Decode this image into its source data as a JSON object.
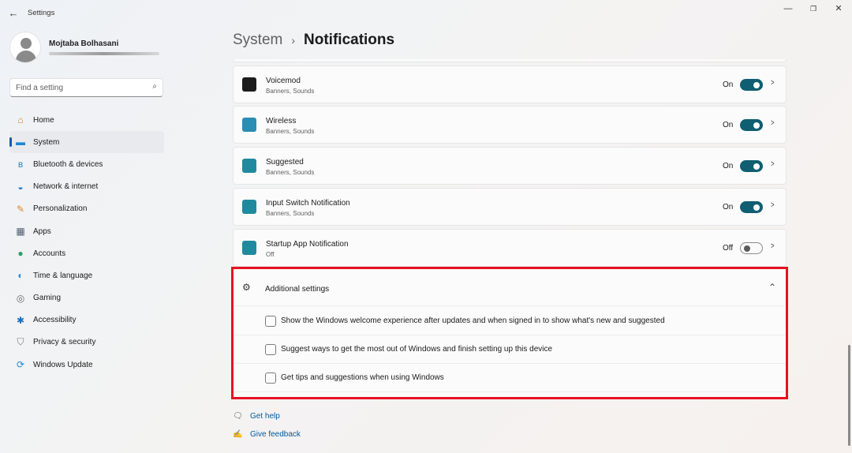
{
  "window": {
    "title": "Settings",
    "back_glyph": "←",
    "minimize_glyph": "—",
    "maximize_glyph": "❐",
    "close_glyph": "✕"
  },
  "profile": {
    "name": "Mojtaba Bolhasani"
  },
  "search": {
    "placeholder": "Find a setting",
    "value": ""
  },
  "sidebar": {
    "items": [
      {
        "label": "Home",
        "icon": "home-icon",
        "glyph": "⌂",
        "color": "#d47b2a",
        "active": false
      },
      {
        "label": "System",
        "icon": "system-icon",
        "glyph": "▬",
        "color": "#1f86d6",
        "active": true
      },
      {
        "label": "Bluetooth & devices",
        "icon": "bluetooth-icon",
        "glyph": "ʙ",
        "color": "#1f86d6",
        "active": false
      },
      {
        "label": "Network & internet",
        "icon": "wifi-icon",
        "glyph": "◒",
        "color": "#2a7ccf",
        "active": false
      },
      {
        "label": "Personalization",
        "icon": "brush-icon",
        "glyph": "✎",
        "color": "#e08a2e",
        "active": false
      },
      {
        "label": "Apps",
        "icon": "apps-icon",
        "glyph": "▦",
        "color": "#4a5a70",
        "active": false
      },
      {
        "label": "Accounts",
        "icon": "accounts-icon",
        "glyph": "●",
        "color": "#2e9e6a",
        "active": false
      },
      {
        "label": "Time & language",
        "icon": "globe-icon",
        "glyph": "◐",
        "color": "#2b8bd6",
        "active": false
      },
      {
        "label": "Gaming",
        "icon": "gamepad-icon",
        "glyph": "◎",
        "color": "#6b6b6b",
        "active": false
      },
      {
        "label": "Accessibility",
        "icon": "accessibility-icon",
        "glyph": "✱",
        "color": "#1a6fc2",
        "active": false
      },
      {
        "label": "Privacy & security",
        "icon": "shield-icon",
        "glyph": "⛉",
        "color": "#7a7a7a",
        "active": false
      },
      {
        "label": "Windows Update",
        "icon": "update-icon",
        "glyph": "⟳",
        "color": "#1f86d6",
        "active": false
      }
    ]
  },
  "header": {
    "parent": "System",
    "separator": "›",
    "current": "Notifications"
  },
  "apps": [
    {
      "name": "Voicemod",
      "sub": "Banners, Sounds",
      "state": "On",
      "on": true,
      "icon": "voicemod-icon",
      "color": "#1c1c1c"
    },
    {
      "name": "Wireless",
      "sub": "Banners, Sounds",
      "state": "On",
      "on": true,
      "icon": "wireless-icon",
      "color": "#2a8db3"
    },
    {
      "name": "Suggested",
      "sub": "Banners, Sounds",
      "state": "On",
      "on": true,
      "icon": "suggested-icon",
      "color": "#1f8a9e"
    },
    {
      "name": "Input Switch Notification",
      "sub": "Banners, Sounds",
      "state": "On",
      "on": true,
      "icon": "input-switch-icon",
      "color": "#1f8a9e"
    },
    {
      "name": "Startup App Notification",
      "sub": "Off",
      "state": "Off",
      "on": false,
      "icon": "startup-app-icon",
      "color": "#1f8a9e"
    }
  ],
  "additional": {
    "title": "Additional settings",
    "options": [
      {
        "label": "Show the Windows welcome experience after updates and when signed in to show what's new and suggested",
        "checked": false
      },
      {
        "label": "Suggest ways to get the most out of Windows and finish setting up this device",
        "checked": false
      },
      {
        "label": "Get tips and suggestions when using Windows",
        "checked": false
      }
    ]
  },
  "footer": {
    "get_help": "Get help",
    "give_feedback": "Give feedback"
  },
  "colors": {
    "accent": "#005fb8",
    "toggle_on": "#0f5e72",
    "highlight": "#e81123",
    "link": "#005a9e"
  }
}
